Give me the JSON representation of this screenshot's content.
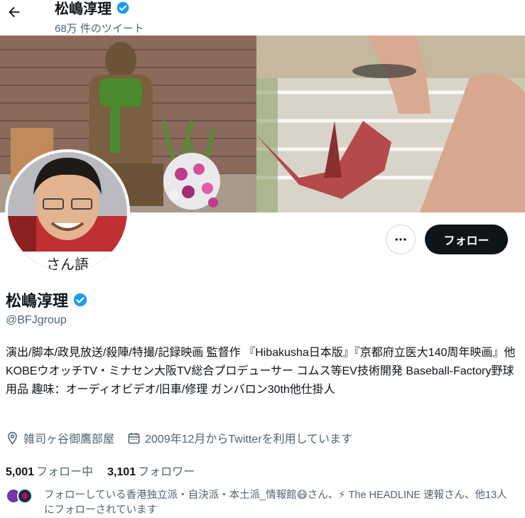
{
  "header": {
    "name": "松嶋淳理",
    "tweet_count": "68万 件のツイート"
  },
  "profile": {
    "name": "松嶋淳理",
    "handle": "@BFJgroup",
    "bio": "演出/脚本/政見放送/殺陣/特撮/記録映画 監督作 『Hibakusha日本版』『京都府立医大140周年映画』他 KOBEウオッチTV・ミナセン大阪TV総合プロデューサー コムス等EV技術開発 Baseball-Factory野球用品 趣味：オーディオビデオ/旧車/修理 ガンバロン30th他仕掛人",
    "location": "雑司ヶ谷御鷹部屋",
    "joined": "2009年12月からTwitterを利用しています",
    "following_count": "5,001",
    "following_label": "フォロー中",
    "followers_count": "3,101",
    "followers_label": "フォロワー",
    "followed_by_text": "フォローしている香港独立派・自決派・本土派_情報館😷さん、⚡ The HEADLINE 速報さん、他13人にフォローされています"
  },
  "actions": {
    "follow_label": "フォロー",
    "more_label": "..."
  },
  "colors": {
    "verified": "#1d9bf0",
    "text_primary": "#0f1419",
    "text_secondary": "#536471",
    "follow_button_bg": "#0f1419"
  },
  "icons": [
    "back-arrow-icon",
    "verified-badge-icon",
    "more-icon",
    "location-icon",
    "calendar-icon"
  ]
}
